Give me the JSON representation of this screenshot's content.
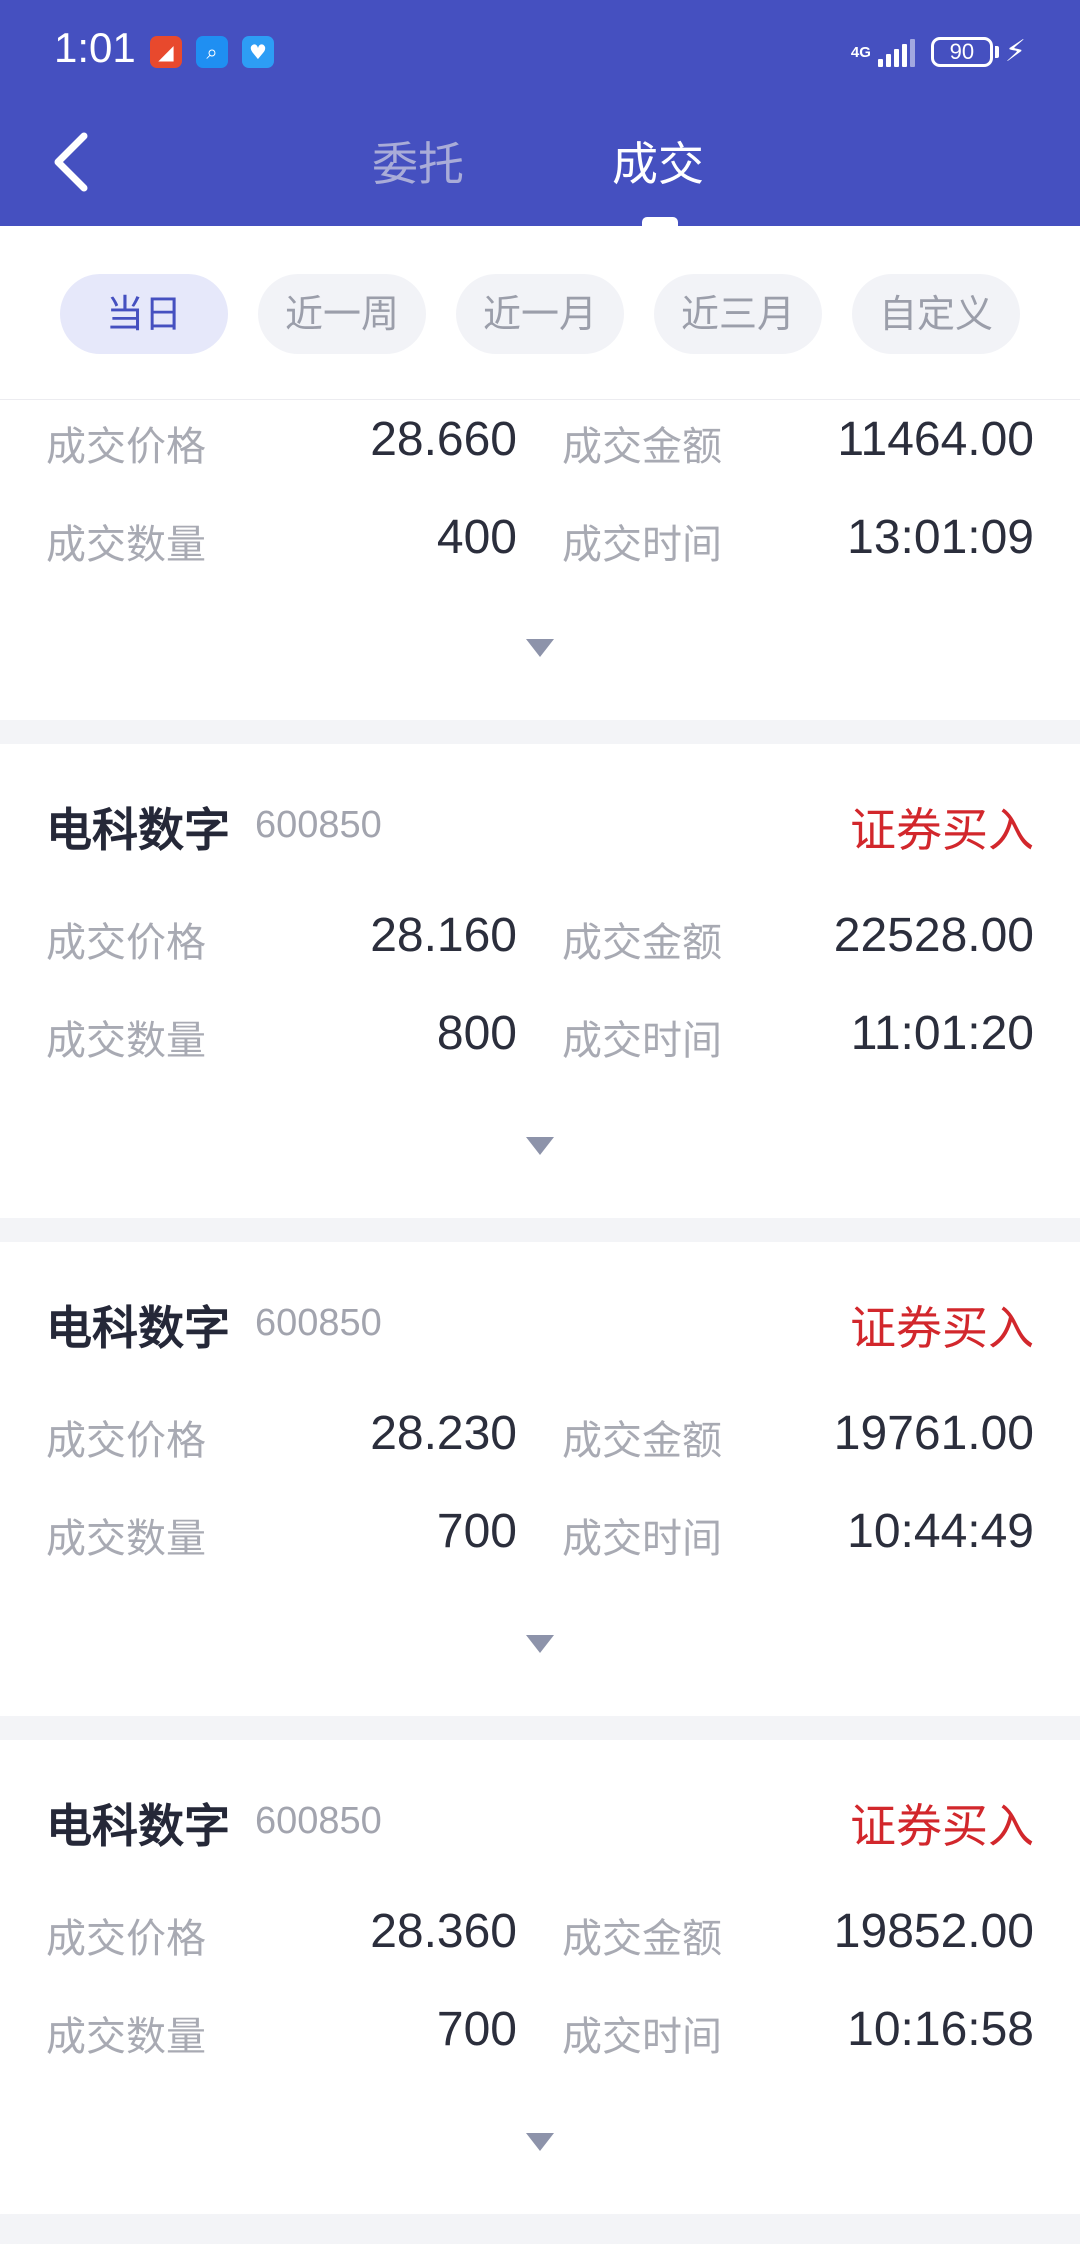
{
  "status_bar": {
    "time": "1:01",
    "network": "4G",
    "battery": "90"
  },
  "header": {
    "tabs": [
      "委托",
      "成交"
    ],
    "active_tab": "成交"
  },
  "filters": [
    "当日",
    "近一周",
    "近一月",
    "近三月",
    "自定义"
  ],
  "active_filter": "当日",
  "labels": {
    "price": "成交价格",
    "amount": "成交金额",
    "quantity": "成交数量",
    "time": "成交时间"
  },
  "records": [
    {
      "name": "",
      "code": "",
      "type": "",
      "price": "28.660",
      "amount": "11464.00",
      "quantity": "400",
      "time": "13:01:09"
    },
    {
      "name": "电科数字",
      "code": "600850",
      "type": "证券买入",
      "price": "28.160",
      "amount": "22528.00",
      "quantity": "800",
      "time": "11:01:20"
    },
    {
      "name": "电科数字",
      "code": "600850",
      "type": "证券买入",
      "price": "28.230",
      "amount": "19761.00",
      "quantity": "700",
      "time": "10:44:49"
    },
    {
      "name": "电科数字",
      "code": "600850",
      "type": "证券买入",
      "price": "28.360",
      "amount": "19852.00",
      "quantity": "700",
      "time": "10:16:58"
    }
  ],
  "colors": {
    "header_bg": "#4550c0",
    "buy_text": "#d2272c",
    "active_chip_bg": "#e6e8fa"
  }
}
